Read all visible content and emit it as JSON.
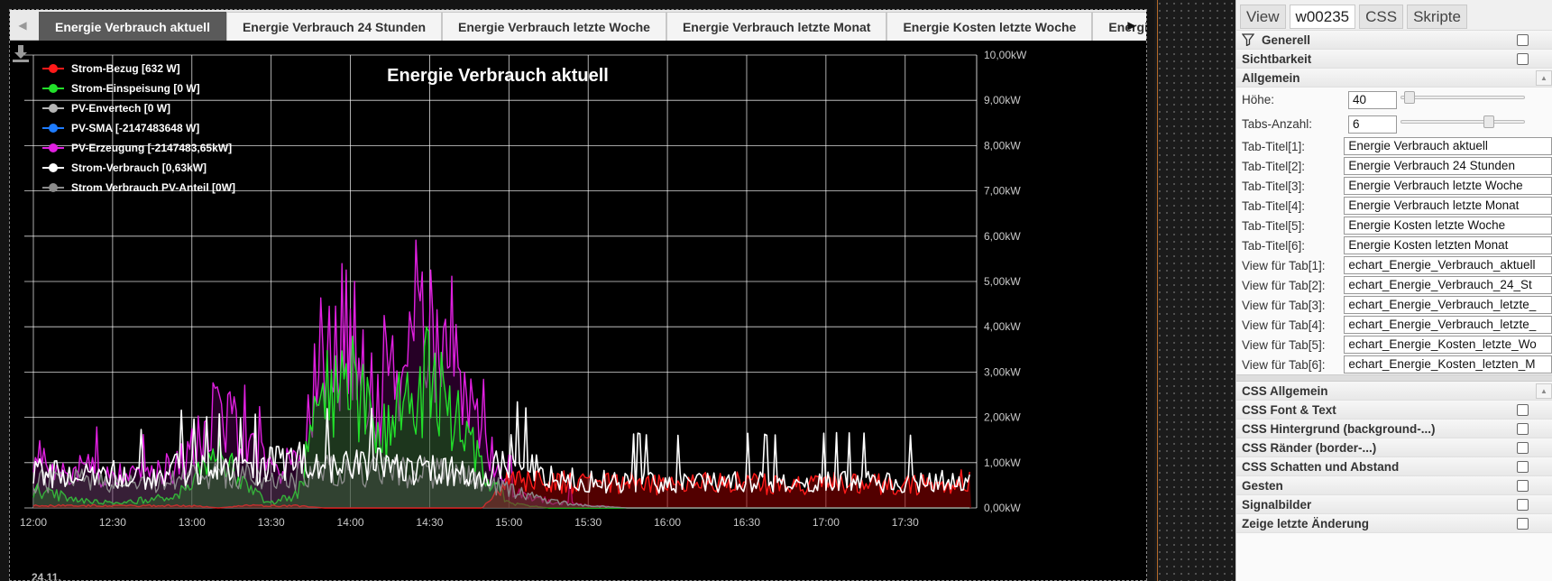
{
  "editor_tabs": [
    {
      "label": "Energie Verbrauch aktuell",
      "active": true
    },
    {
      "label": "Energie Verbrauch 24 Stunden"
    },
    {
      "label": "Energie Verbrauch letzte Woche"
    },
    {
      "label": "Energie Verbrauch letzte Monat"
    },
    {
      "label": "Energie Kosten letzte Woche"
    },
    {
      "label": "Energie Kosten"
    }
  ],
  "chart": {
    "title": "Energie Verbrauch aktuell",
    "date_label": "24.11.",
    "legend": [
      {
        "label": "Strom-Bezug [632 W]",
        "color": "#ff1a1a"
      },
      {
        "label": "Strom-Einspeisung [0 W]",
        "color": "#22e02a"
      },
      {
        "label": "PV-Envertech [0 W]",
        "color": "#b5b5b5"
      },
      {
        "label": "PV-SMA [-2147483648 W]",
        "color": "#1e7cff"
      },
      {
        "label": "PV-Erzeugung [-2147483,65kW]",
        "color": "#e020e0"
      },
      {
        "label": "Strom-Verbrauch [0,63kW]",
        "color": "#ffffff"
      },
      {
        "label": "Strom Verbrauch PV-Anteil [0W]",
        "color": "#8a8a8a"
      }
    ]
  },
  "chart_data": {
    "type": "area",
    "title": "Energie Verbrauch aktuell",
    "x_ticks": [
      "12:00",
      "12:30",
      "13:00",
      "13:30",
      "14:00",
      "14:30",
      "15:00",
      "15:30",
      "16:00",
      "16:30",
      "17:00",
      "17:30"
    ],
    "y_ticks": [
      "0,00kW",
      "1,00kW",
      "2,00kW",
      "3,00kW",
      "4,00kW",
      "5,00kW",
      "6,00kW",
      "7,00kW",
      "8,00kW",
      "9,00kW",
      "10,00kW"
    ],
    "ylim": [
      0,
      10
    ],
    "y_unit": "kW",
    "x_minutes": [
      0,
      15,
      30,
      45,
      55,
      60,
      70,
      80,
      90,
      100,
      110,
      120,
      130,
      140,
      150,
      160,
      170,
      180,
      195,
      210,
      225,
      240,
      255,
      270,
      285,
      300,
      315,
      330,
      345,
      355
    ],
    "series": [
      {
        "name": "Strom-Verbrauch",
        "color": "#ffffff",
        "values": [
          0.9,
          0.7,
          0.8,
          0.6,
          1.0,
          0.8,
          0.9,
          0.8,
          1.0,
          1.1,
          1.0,
          0.9,
          1.0,
          0.8,
          0.9,
          0.8,
          0.6,
          1.2,
          0.7,
          0.6,
          0.6,
          0.55,
          0.6,
          0.6,
          0.55,
          0.6,
          0.6,
          0.55,
          0.6,
          0.65
        ]
      },
      {
        "name": "PV-Erzeugung",
        "color": "#e020e0",
        "values": [
          1.1,
          0.9,
          0.8,
          0.7,
          1.0,
          1.3,
          2.2,
          1.5,
          0.9,
          1.1,
          3.7,
          4.0,
          2.2,
          3.6,
          3.8,
          3.0,
          1.6,
          0.4,
          0.15,
          0.05,
          0.0,
          0.0,
          0.0,
          0.0,
          0.0,
          0.0,
          0.0,
          0.0,
          0.0,
          0.0
        ]
      },
      {
        "name": "Strom-Einspeisung",
        "color": "#22e02a",
        "values": [
          0.4,
          0.2,
          0.1,
          0.2,
          0.3,
          0.6,
          1.2,
          0.5,
          0.1,
          0.3,
          2.6,
          3.1,
          1.4,
          2.6,
          2.8,
          2.0,
          0.9,
          0.1,
          0.0,
          0.0,
          0.0,
          0.0,
          0.0,
          0.0,
          0.0,
          0.0,
          0.0,
          0.0,
          0.0,
          0.0
        ]
      },
      {
        "name": "Strom Verbrauch PV-Anteil",
        "color": "#8a8a8a",
        "values": [
          0.6,
          0.6,
          0.6,
          0.5,
          0.6,
          0.7,
          0.8,
          0.7,
          0.6,
          0.7,
          0.9,
          0.8,
          0.8,
          0.8,
          0.8,
          0.7,
          0.6,
          0.4,
          0.15,
          0.05,
          0.0,
          0.0,
          0.0,
          0.0,
          0.0,
          0.0,
          0.0,
          0.0,
          0.0,
          0.0
        ]
      },
      {
        "name": "Strom-Bezug",
        "color": "#ff1a1a",
        "values": [
          0.05,
          0.05,
          0.05,
          0.05,
          0.05,
          0.05,
          0.0,
          0.05,
          0.05,
          0.05,
          0.0,
          0.0,
          0.0,
          0.0,
          0.0,
          0.0,
          0.0,
          0.6,
          0.6,
          0.55,
          0.55,
          0.5,
          0.55,
          0.55,
          0.5,
          0.55,
          0.55,
          0.5,
          0.55,
          0.6
        ]
      }
    ]
  },
  "panel": {
    "tabs": [
      {
        "label": "View"
      },
      {
        "label": "w00235",
        "active": true
      },
      {
        "label": "CSS"
      },
      {
        "label": "Skripte"
      }
    ],
    "groups_top": [
      {
        "label": "Generell",
        "icon": "filter-icon"
      },
      {
        "label": "Sichtbarkeit"
      }
    ],
    "allgemein": {
      "label": "Allgemein",
      "hoehe_label": "Höhe:",
      "hoehe_value": "40",
      "hoehe_slider": 0.02,
      "tabs_anzahl_label": "Tabs-Anzahl:",
      "tabs_anzahl_value": "6",
      "tabs_anzahl_slider": 0.72,
      "tab_titles": [
        {
          "label": "Tab-Titel[1]:",
          "value": "Energie Verbrauch aktuell"
        },
        {
          "label": "Tab-Titel[2]:",
          "value": "Energie Verbrauch 24 Stunden"
        },
        {
          "label": "Tab-Titel[3]:",
          "value": "Energie Verbrauch letzte Woche"
        },
        {
          "label": "Tab-Titel[4]:",
          "value": "Energie Verbrauch letzte Monat"
        },
        {
          "label": "Tab-Titel[5]:",
          "value": "Energie Kosten letzte Woche"
        },
        {
          "label": "Tab-Titel[6]:",
          "value": "Energie Kosten letzten Monat"
        }
      ],
      "tab_views": [
        {
          "label": "View für Tab[1]:",
          "value": "echart_Energie_Verbrauch_aktuell"
        },
        {
          "label": "View für Tab[2]:",
          "value": "echart_Energie_Verbrauch_24_St"
        },
        {
          "label": "View für Tab[3]:",
          "value": "echart_Energie_Verbrauch_letzte_"
        },
        {
          "label": "View für Tab[4]:",
          "value": "echart_Energie_Verbrauch_letzte_"
        },
        {
          "label": "View für Tab[5]:",
          "value": "echart_Energie_Kosten_letzte_Wo"
        },
        {
          "label": "View für Tab[6]:",
          "value": "echart_Energie_Kosten_letzten_M"
        }
      ]
    },
    "css_allgemein": "CSS Allgemein",
    "groups_bottom": [
      {
        "label": "CSS Font & Text"
      },
      {
        "label": "CSS Hintergrund (background-...)"
      },
      {
        "label": "CSS Ränder (border-...)"
      },
      {
        "label": "CSS Schatten und Abstand"
      },
      {
        "label": "Gesten"
      },
      {
        "label": "Signalbilder"
      },
      {
        "label": "Zeige letzte Änderung"
      }
    ]
  }
}
